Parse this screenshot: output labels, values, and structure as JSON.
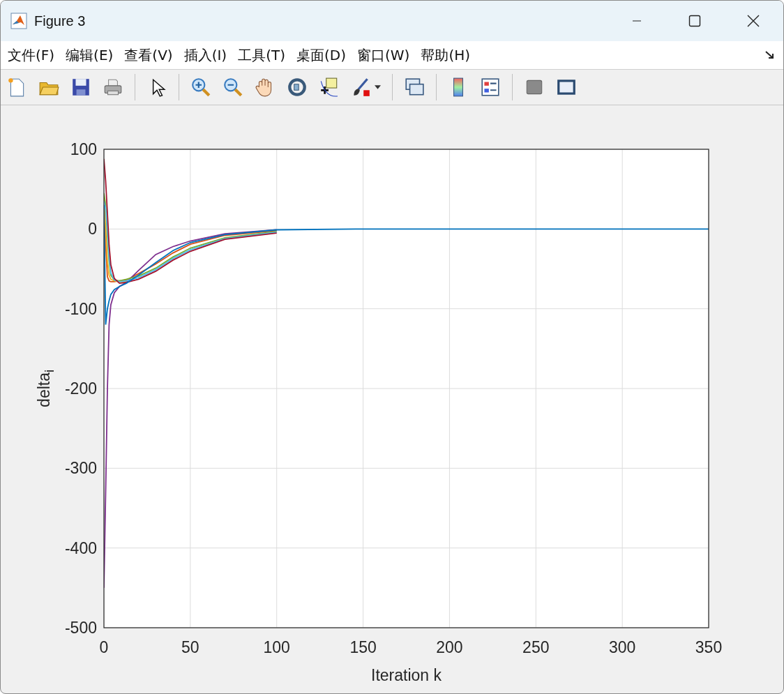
{
  "window": {
    "title": "Figure 3"
  },
  "menu": [
    {
      "label": "文件(F)"
    },
    {
      "label": "编辑(E)"
    },
    {
      "label": "查看(V)"
    },
    {
      "label": "插入(I)"
    },
    {
      "label": "工具(T)"
    },
    {
      "label": "桌面(D)"
    },
    {
      "label": "窗口(W)"
    },
    {
      "label": "帮助(H)"
    }
  ],
  "figure": {
    "chart_data": {
      "type": "line",
      "xlabel": "Iteration k",
      "ylabel": "delta$_{i}$",
      "grid": true,
      "x": [
        0,
        1,
        2,
        3,
        4,
        6,
        9,
        13,
        20,
        30,
        40,
        50,
        70,
        100,
        150,
        200,
        350
      ],
      "xlim": [
        0,
        350
      ],
      "ylim": [
        -500,
        100
      ],
      "xticks": [
        0,
        50,
        100,
        150,
        200,
        250,
        300,
        350
      ],
      "yticks": [
        -500,
        -400,
        -300,
        -200,
        -100,
        0,
        100
      ],
      "series": [
        {
          "color": "#d95319",
          "values": [
            20,
            -20,
            -60,
            -65,
            -66,
            -66,
            -65,
            -64,
            -56,
            -44,
            -30,
            -19,
            -8,
            -2,
            null,
            null,
            null
          ]
        },
        {
          "color": "#edb120",
          "values": [
            40,
            0,
            -40,
            -58,
            -63,
            -65,
            -66,
            -66,
            null,
            null,
            null,
            null,
            null,
            null,
            null,
            null,
            null
          ]
        },
        {
          "color": "#7e2f8e",
          "values": [
            -450,
            -330,
            -200,
            -120,
            -95,
            -80,
            -72,
            -67,
            -52,
            -32,
            -22,
            -15,
            -6,
            -1,
            null,
            null,
            null
          ]
        },
        {
          "color": "#77ac30",
          "values": [
            45,
            30,
            -10,
            -40,
            -58,
            -64,
            -65,
            -63,
            -59,
            -49,
            -35,
            -24,
            -11,
            -3,
            null,
            null,
            null
          ]
        },
        {
          "color": "#4dbeee",
          "values": [
            35,
            25,
            0,
            -35,
            -55,
            -64,
            -66,
            -65,
            -61,
            -51,
            -37,
            -26,
            -12,
            -4,
            null,
            null,
            null
          ]
        },
        {
          "color": "#a2142f",
          "values": [
            88,
            60,
            20,
            -20,
            -45,
            -62,
            -68,
            -67,
            -63,
            -53,
            -39,
            -28,
            -13,
            -5,
            null,
            null,
            null
          ]
        },
        {
          "color": "#0072bd",
          "values": [
            30,
            -120,
            -100,
            -90,
            -82,
            -76,
            -72,
            -68,
            -58,
            -42,
            -27,
            -17,
            -7,
            -1,
            0,
            0,
            0
          ]
        }
      ]
    }
  }
}
